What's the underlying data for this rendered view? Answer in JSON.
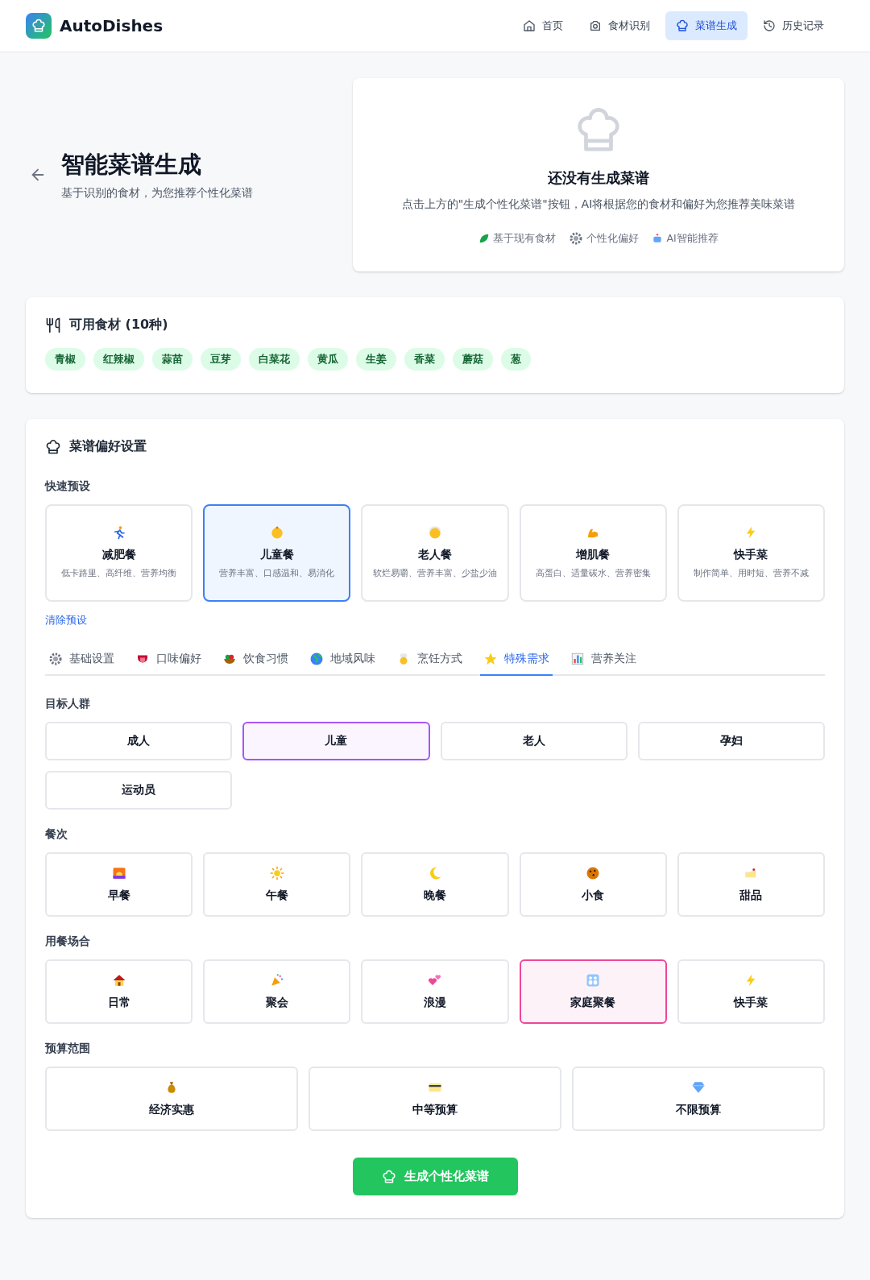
{
  "brand": "AutoDishes",
  "nav": [
    {
      "label": "首页",
      "selected": false
    },
    {
      "label": "食材识别",
      "selected": false
    },
    {
      "label": "菜谱生成",
      "selected": true
    },
    {
      "label": "历史记录",
      "selected": false
    }
  ],
  "page": {
    "title": "智能菜谱生成",
    "subtitle": "基于识别的食材，为您推荐个性化菜谱"
  },
  "empty_state": {
    "title": "还没有生成菜谱",
    "message": "点击上方的\"生成个性化菜谱\"按钮，AI将根据您的食材和偏好为您推荐美味菜谱",
    "features": [
      "基于现有食材",
      "个性化偏好",
      "AI智能推荐"
    ]
  },
  "ingredients": {
    "title": "可用食材 (10种)",
    "items": [
      "青椒",
      "红辣椒",
      "蒜苗",
      "豆芽",
      "白菜花",
      "黄瓜",
      "生姜",
      "香菜",
      "蘑菇",
      "葱"
    ]
  },
  "preferences": {
    "title": "菜谱偏好设置",
    "presets_label": "快速预设",
    "presets": [
      {
        "name": "减肥餐",
        "desc": "低卡路里、高纤维、营养均衡",
        "selected": false
      },
      {
        "name": "儿童餐",
        "desc": "营养丰富、口感温和、易消化",
        "selected": true
      },
      {
        "name": "老人餐",
        "desc": "软烂易嚼、营养丰富、少盐少油",
        "selected": false
      },
      {
        "name": "增肌餐",
        "desc": "高蛋白、适量碳水、营养密集",
        "selected": false
      },
      {
        "name": "快手菜",
        "desc": "制作简单、用时短、营养不减",
        "selected": false
      }
    ],
    "clear": "清除预设",
    "tabs": [
      {
        "label": "基础设置",
        "selected": false
      },
      {
        "label": "口味偏好",
        "selected": false
      },
      {
        "label": "饮食习惯",
        "selected": false
      },
      {
        "label": "地域风味",
        "selected": false
      },
      {
        "label": "烹饪方式",
        "selected": false
      },
      {
        "label": "特殊需求",
        "selected": true
      },
      {
        "label": "营养关注",
        "selected": false
      }
    ],
    "groups": [
      {
        "label": "目标人群",
        "kind": "plain",
        "options": [
          {
            "label": "成人",
            "selected": false
          },
          {
            "label": "儿童",
            "selected": true
          },
          {
            "label": "老人",
            "selected": false
          },
          {
            "label": "孕妇",
            "selected": false
          },
          {
            "label": "运动员",
            "selected": false
          }
        ]
      },
      {
        "label": "餐次",
        "kind": "meal",
        "options": [
          {
            "label": "早餐",
            "selected": false
          },
          {
            "label": "午餐",
            "selected": false
          },
          {
            "label": "晚餐",
            "selected": false
          },
          {
            "label": "小食",
            "selected": false
          },
          {
            "label": "甜品",
            "selected": false
          }
        ]
      },
      {
        "label": "用餐场合",
        "kind": "occasion",
        "options": [
          {
            "label": "日常",
            "selected": false
          },
          {
            "label": "聚会",
            "selected": false
          },
          {
            "label": "浪漫",
            "selected": false
          },
          {
            "label": "家庭聚餐",
            "selected": true
          },
          {
            "label": "快手菜",
            "selected": false
          }
        ]
      },
      {
        "label": "预算范围",
        "kind": "budget",
        "options": [
          {
            "label": "经济实惠",
            "selected": false
          },
          {
            "label": "中等预算",
            "selected": false
          },
          {
            "label": "不限预算",
            "selected": false
          }
        ]
      }
    ]
  },
  "generate_button": "生成个性化菜谱"
}
